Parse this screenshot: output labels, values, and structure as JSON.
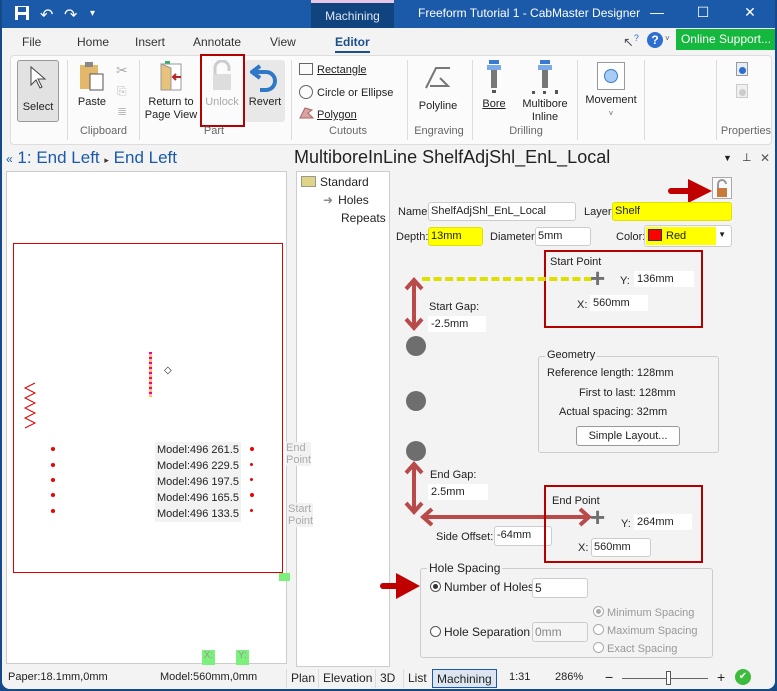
{
  "titlebar": {
    "app_title": "Freeform Tutorial 1 - CabMaster Designer",
    "context_tab": "Machining",
    "quick_access": [
      "save-icon",
      "undo-icon",
      "redo-icon",
      "customize-icon"
    ],
    "minimize": "—",
    "maximize": "☐",
    "close": "✕"
  },
  "menu_tabs": [
    "File",
    "Home",
    "Insert",
    "Annotate",
    "View",
    "Editor"
  ],
  "active_tab": "Editor",
  "help": {
    "online_support": "Online Support..."
  },
  "ribbon": {
    "select": "Select",
    "paste": "Paste",
    "clipboard_group": "Clipboard",
    "return_to_page_view": [
      "Return to",
      "Page View"
    ],
    "unlock": "Unlock",
    "revert": "Revert",
    "part_group": "Part",
    "rectangle": "Rectangle",
    "circle_ellipse": "Circle or Ellipse",
    "polygon": "Polygon",
    "cutouts_group": "Cutouts",
    "polyline": "Polyline",
    "engraving_group": "Engraving",
    "bore": "Bore",
    "multibore_inline": [
      "Multibore",
      "Inline"
    ],
    "drilling_group": "Drilling",
    "movement": "Movement",
    "properties_group": "Properties"
  },
  "left_pane": {
    "collapse": "«",
    "breadcrumb_1": "1: End Left",
    "breadcrumb_2": "End Left",
    "model_labels": [
      "Model:496 261.5",
      "Model:496 229.5",
      "Model:496 197.5",
      "Model:496 165.5",
      "Model:496 133.5"
    ],
    "end_point_label": "End Point",
    "start_point_label": "Start Point",
    "x_marker": "X:",
    "y_marker": "Y:"
  },
  "right_pane": {
    "title": "MultiboreInLine ShelfAdjShl_EnL_Local",
    "tree": {
      "root": "Standard",
      "items": [
        "Holes",
        "Repeats"
      ],
      "selected": "Holes"
    },
    "name_label": "Name:",
    "name_value": "ShelfAdjShl_EnL_Local",
    "layer_label": "Layer:",
    "layer_value": "Shelf",
    "depth_label": "Depth:",
    "depth_value": "13mm",
    "diameter_label": "Diameter:",
    "diameter_value": "5mm",
    "color_label": "Color:",
    "color_value": "Red",
    "color_swatch": "#ff0000",
    "start_point": {
      "title": "Start Point",
      "y_label": "Y:",
      "y_value": "136mm",
      "x_label": "X:",
      "x_value": "560mm"
    },
    "start_gap": {
      "label": "Start Gap:",
      "value": "-2.5mm"
    },
    "geometry": {
      "title": "Geometry",
      "reference_length": "Reference length: 128mm",
      "first_to_last": "First to last: 128mm",
      "actual_spacing": "Actual spacing: 32mm",
      "simple_layout": "Simple Layout..."
    },
    "end_gap": {
      "label": "End Gap:",
      "value": "2.5mm"
    },
    "side_offset": {
      "label": "Side Offset:",
      "value": "-64mm"
    },
    "end_point": {
      "title": "End Point",
      "y_label": "Y:",
      "y_value": "264mm",
      "x_label": "X:",
      "x_value": "560mm"
    },
    "hole_spacing": {
      "title": "Hole Spacing",
      "number_of_holes_label": "Number of Holes",
      "number_of_holes_value": "5",
      "hole_separation_label": "Hole Separation",
      "hole_separation_value": "0mm",
      "minimum_spacing": "Minimum Spacing",
      "maximum_spacing": "Maximum Spacing",
      "exact_spacing": "Exact Spacing"
    }
  },
  "statusbar": {
    "paper": "Paper:18.1mm,0mm",
    "model": "Model:560mm,0mm",
    "view_tabs": [
      "Plan",
      "Elevation",
      "3D",
      "List",
      "Machining"
    ],
    "active_view": "Machining",
    "scale": "1:31",
    "zoom": "286%",
    "zoom_minus": "−",
    "zoom_plus": "+"
  },
  "colors": {
    "accent": "#1a5aa8",
    "highlight": "#ffff00",
    "annotation_red": "#b30000",
    "online_green": "#14b83c"
  }
}
